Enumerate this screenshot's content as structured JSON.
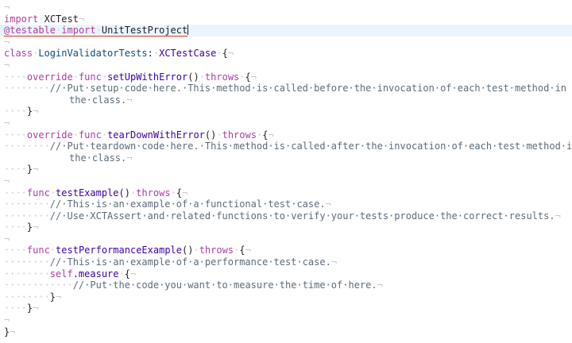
{
  "editor": {
    "language": "swift",
    "colors": {
      "keyword": "#ad3da4",
      "function": "#3900a0",
      "type": "#0b4f79",
      "comment": "#5d6c79",
      "invisible": "#c6c9ce",
      "current_line": "#ebf4fe",
      "error_underline": "#d93a2b"
    },
    "lines": [
      {
        "tokens": [
          {
            "t": "¬",
            "c": "ws"
          }
        ]
      },
      {
        "tokens": [
          {
            "t": "import",
            "c": "kw"
          },
          {
            "t": "·",
            "c": "ws"
          },
          {
            "t": "XCTest",
            "c": "pun"
          },
          {
            "t": "¬",
            "c": "ws"
          }
        ]
      },
      {
        "current": true,
        "tokens": [
          {
            "t": "@testable",
            "c": "kw",
            "u": true
          },
          {
            "t": "·",
            "c": "ws",
            "u": true
          },
          {
            "t": "import",
            "c": "kw",
            "u": true
          },
          {
            "t": "·",
            "c": "ws",
            "u": true
          },
          {
            "t": "UnitTestProject",
            "c": "pun",
            "u": true
          },
          {
            "cursor": true
          }
        ]
      },
      {
        "tokens": [
          {
            "t": "¬",
            "c": "ws"
          }
        ]
      },
      {
        "tokens": [
          {
            "t": "class",
            "c": "kw"
          },
          {
            "t": "·",
            "c": "ws"
          },
          {
            "t": "LoginValidatorTests",
            "c": "ty"
          },
          {
            "t": ":",
            "c": "pun"
          },
          {
            "t": "·",
            "c": "ws"
          },
          {
            "t": "XCTestCase",
            "c": "tp"
          },
          {
            "t": "·",
            "c": "ws"
          },
          {
            "t": "{",
            "c": "pun"
          },
          {
            "t": "¬",
            "c": "ws"
          }
        ]
      },
      {
        "tokens": [
          {
            "t": "¬",
            "c": "ws"
          }
        ]
      },
      {
        "tokens": [
          {
            "t": "····",
            "c": "ws"
          },
          {
            "t": "override",
            "c": "kw"
          },
          {
            "t": "·",
            "c": "ws"
          },
          {
            "t": "func",
            "c": "kw"
          },
          {
            "t": "·",
            "c": "ws"
          },
          {
            "t": "setUpWithError",
            "c": "fn"
          },
          {
            "t": "()",
            "c": "pun"
          },
          {
            "t": "·",
            "c": "ws"
          },
          {
            "t": "throws",
            "c": "kw"
          },
          {
            "t": "·",
            "c": "ws"
          },
          {
            "t": "{",
            "c": "pun"
          },
          {
            "t": "¬",
            "c": "ws"
          }
        ]
      },
      {
        "tokens": [
          {
            "t": "········",
            "c": "ws"
          },
          {
            "t": "//·Put·setup·code·here.·This·method·is·called·before·the·invocation·of·each·test·method·in",
            "c": "cm"
          }
        ]
      },
      {
        "wrap": true,
        "tokens": [
          {
            "t": "the·class.",
            "c": "cm"
          },
          {
            "t": "¬",
            "c": "ws"
          }
        ]
      },
      {
        "tokens": [
          {
            "t": "····",
            "c": "ws"
          },
          {
            "t": "}",
            "c": "pun"
          },
          {
            "t": "¬",
            "c": "ws"
          }
        ]
      },
      {
        "tokens": [
          {
            "t": "¬",
            "c": "ws"
          }
        ]
      },
      {
        "tokens": [
          {
            "t": "····",
            "c": "ws"
          },
          {
            "t": "override",
            "c": "kw"
          },
          {
            "t": "·",
            "c": "ws"
          },
          {
            "t": "func",
            "c": "kw"
          },
          {
            "t": "·",
            "c": "ws"
          },
          {
            "t": "tearDownWithError",
            "c": "fn"
          },
          {
            "t": "()",
            "c": "pun"
          },
          {
            "t": "·",
            "c": "ws"
          },
          {
            "t": "throws",
            "c": "kw"
          },
          {
            "t": "·",
            "c": "ws"
          },
          {
            "t": "{",
            "c": "pun"
          },
          {
            "t": "¬",
            "c": "ws"
          }
        ]
      },
      {
        "tokens": [
          {
            "t": "········",
            "c": "ws"
          },
          {
            "t": "//·Put·teardown·code·here.·This·method·is·called·after·the·invocation·of·each·test·method·in",
            "c": "cm"
          }
        ]
      },
      {
        "wrap": true,
        "tokens": [
          {
            "t": "the·class.",
            "c": "cm"
          },
          {
            "t": "¬",
            "c": "ws"
          }
        ]
      },
      {
        "tokens": [
          {
            "t": "····",
            "c": "ws"
          },
          {
            "t": "}",
            "c": "pun"
          },
          {
            "t": "¬",
            "c": "ws"
          }
        ]
      },
      {
        "tokens": [
          {
            "t": "¬",
            "c": "ws"
          }
        ]
      },
      {
        "tokens": [
          {
            "t": "····",
            "c": "ws"
          },
          {
            "t": "func",
            "c": "kw"
          },
          {
            "t": "·",
            "c": "ws"
          },
          {
            "t": "testExample",
            "c": "fn"
          },
          {
            "t": "()",
            "c": "pun"
          },
          {
            "t": "·",
            "c": "ws"
          },
          {
            "t": "throws",
            "c": "kw"
          },
          {
            "t": "·",
            "c": "ws"
          },
          {
            "t": "{",
            "c": "pun"
          },
          {
            "t": "¬",
            "c": "ws"
          }
        ]
      },
      {
        "tokens": [
          {
            "t": "········",
            "c": "ws"
          },
          {
            "t": "//·This·is·an·example·of·a·functional·test·case.",
            "c": "cm"
          },
          {
            "t": "¬",
            "c": "ws"
          }
        ]
      },
      {
        "tokens": [
          {
            "t": "········",
            "c": "ws"
          },
          {
            "t": "//·Use·XCTAssert·and·related·functions·to·verify·your·tests·produce·the·correct·results.",
            "c": "cm"
          },
          {
            "t": "¬",
            "c": "ws"
          }
        ]
      },
      {
        "tokens": [
          {
            "t": "····",
            "c": "ws"
          },
          {
            "t": "}",
            "c": "pun"
          },
          {
            "t": "¬",
            "c": "ws"
          }
        ]
      },
      {
        "tokens": [
          {
            "t": "¬",
            "c": "ws"
          }
        ]
      },
      {
        "tokens": [
          {
            "t": "····",
            "c": "ws"
          },
          {
            "t": "func",
            "c": "kw"
          },
          {
            "t": "·",
            "c": "ws"
          },
          {
            "t": "testPerformanceExample",
            "c": "fn"
          },
          {
            "t": "()",
            "c": "pun"
          },
          {
            "t": "·",
            "c": "ws"
          },
          {
            "t": "throws",
            "c": "kw"
          },
          {
            "t": "·",
            "c": "ws"
          },
          {
            "t": "{",
            "c": "pun"
          },
          {
            "t": "¬",
            "c": "ws"
          }
        ]
      },
      {
        "tokens": [
          {
            "t": "········",
            "c": "ws"
          },
          {
            "t": "//·This·is·an·example·of·a·performance·test·case.",
            "c": "cm"
          },
          {
            "t": "¬",
            "c": "ws"
          }
        ]
      },
      {
        "tokens": [
          {
            "t": "········",
            "c": "ws"
          },
          {
            "t": "self",
            "c": "kw"
          },
          {
            "t": ".measure",
            "c": "fn"
          },
          {
            "t": "·",
            "c": "ws"
          },
          {
            "t": "{",
            "c": "pun"
          },
          {
            "t": "¬",
            "c": "ws"
          }
        ]
      },
      {
        "tokens": [
          {
            "t": "············",
            "c": "ws"
          },
          {
            "t": "//·Put·the·code·you·want·to·measure·the·time·of·here.",
            "c": "cm"
          },
          {
            "t": "¬",
            "c": "ws"
          }
        ]
      },
      {
        "tokens": [
          {
            "t": "········",
            "c": "ws"
          },
          {
            "t": "}",
            "c": "pun"
          },
          {
            "t": "¬",
            "c": "ws"
          }
        ]
      },
      {
        "tokens": [
          {
            "t": "····",
            "c": "ws"
          },
          {
            "t": "}",
            "c": "pun"
          },
          {
            "t": "¬",
            "c": "ws"
          }
        ]
      },
      {
        "tokens": [
          {
            "t": "¬",
            "c": "ws"
          }
        ]
      },
      {
        "tokens": [
          {
            "t": "}",
            "c": "pun"
          },
          {
            "t": "¬",
            "c": "ws"
          }
        ]
      }
    ]
  }
}
